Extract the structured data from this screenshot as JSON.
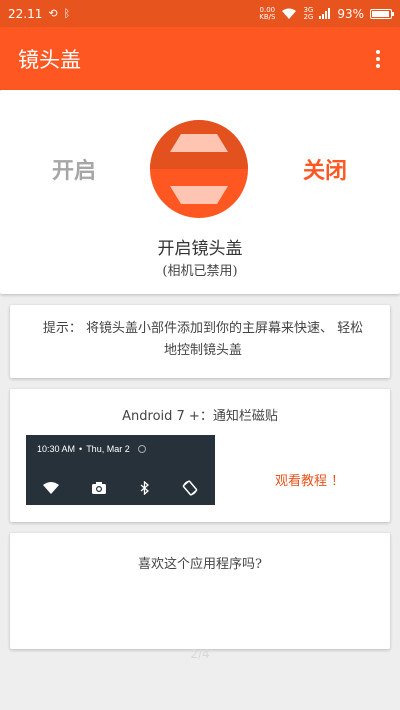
{
  "status_bar": {
    "time": "22.11",
    "net_speed_value": "0.00",
    "net_speed_unit": "KB/S",
    "sim1": "3G",
    "sim2": "2G",
    "battery": "93%"
  },
  "app_bar": {
    "title": "镜头盖",
    "menu_icon": "more-vert-icon"
  },
  "lens_toggle": {
    "on_label": "开启",
    "off_label": "关闭",
    "selected": "off",
    "title": "开启镜头盖",
    "subtitle": "(相机已禁用)"
  },
  "tip": {
    "text": "提示： 将镜头盖小部件添加到你的主屏幕来快速、 轻松地控制镜头盖"
  },
  "quick_tile": {
    "title": "Android 7 +：通知栏磁贴",
    "preview_time": "10:30 AM",
    "preview_date": "Thu, Mar 2",
    "preview_icons": [
      "wifi-icon",
      "camera-icon",
      "bluetooth-icon",
      "rotate-icon"
    ],
    "tutorial_label": "观看教程 ！"
  },
  "like_card": {
    "title": "喜欢这个应用程序吗?"
  },
  "page_indicator": "2/4",
  "colors": {
    "status_bar": "#e8541e",
    "app_bar": "#ff5722",
    "accent": "#ff5722",
    "inactive": "#a6a6a6"
  }
}
